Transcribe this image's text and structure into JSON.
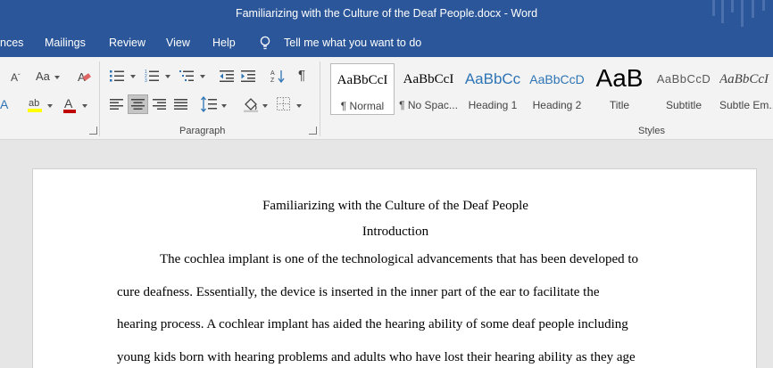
{
  "window": {
    "title": "Familiarizing with the Culture of the Deaf People.docx  -  Word"
  },
  "menu": {
    "tabs": [
      "nces",
      "Mailings",
      "Review",
      "View",
      "Help"
    ],
    "tell_me": "Tell me what you want to do"
  },
  "ribbon": {
    "font_group": {
      "change_case": "Aa"
    },
    "paragraph_group": {
      "label": "Paragraph"
    },
    "styles_group": {
      "label": "Styles",
      "styles": [
        {
          "preview": "AaBbCcI",
          "name": "¶ Normal",
          "selected": true
        },
        {
          "preview": "AaBbCcI",
          "name": "¶ No Spac..."
        },
        {
          "preview": "AaBbCc",
          "name": "Heading 1"
        },
        {
          "preview": "AaBbCcD",
          "name": "Heading 2"
        },
        {
          "preview": "AaB",
          "name": "Title"
        },
        {
          "preview": "AaBbCcD",
          "name": "Subtitle"
        },
        {
          "preview": "AaBbCcI",
          "name": "Subtle Em..."
        }
      ]
    }
  },
  "document": {
    "title": "Familiarizing with the Culture of the Deaf People",
    "heading": "Introduction",
    "lines": [
      "The cochlea implant is one of the technological advancements that has been developed to",
      "cure deafness. Essentially, the device is inserted in the inner part of the ear to facilitate the",
      "hearing process. A cochlear implant has aided the hearing ability of some deaf people including",
      "young kids born with hearing problems and adults who have lost their hearing ability as they age"
    ]
  },
  "colors": {
    "title_bar": "#2b579a",
    "ribbon_bg": "#f3f3f3",
    "workspace_bg": "#e6e6e6",
    "highlight_yellow": "#ffff00",
    "font_color_red": "#c00000",
    "heading_blue": "#2e74b5"
  }
}
